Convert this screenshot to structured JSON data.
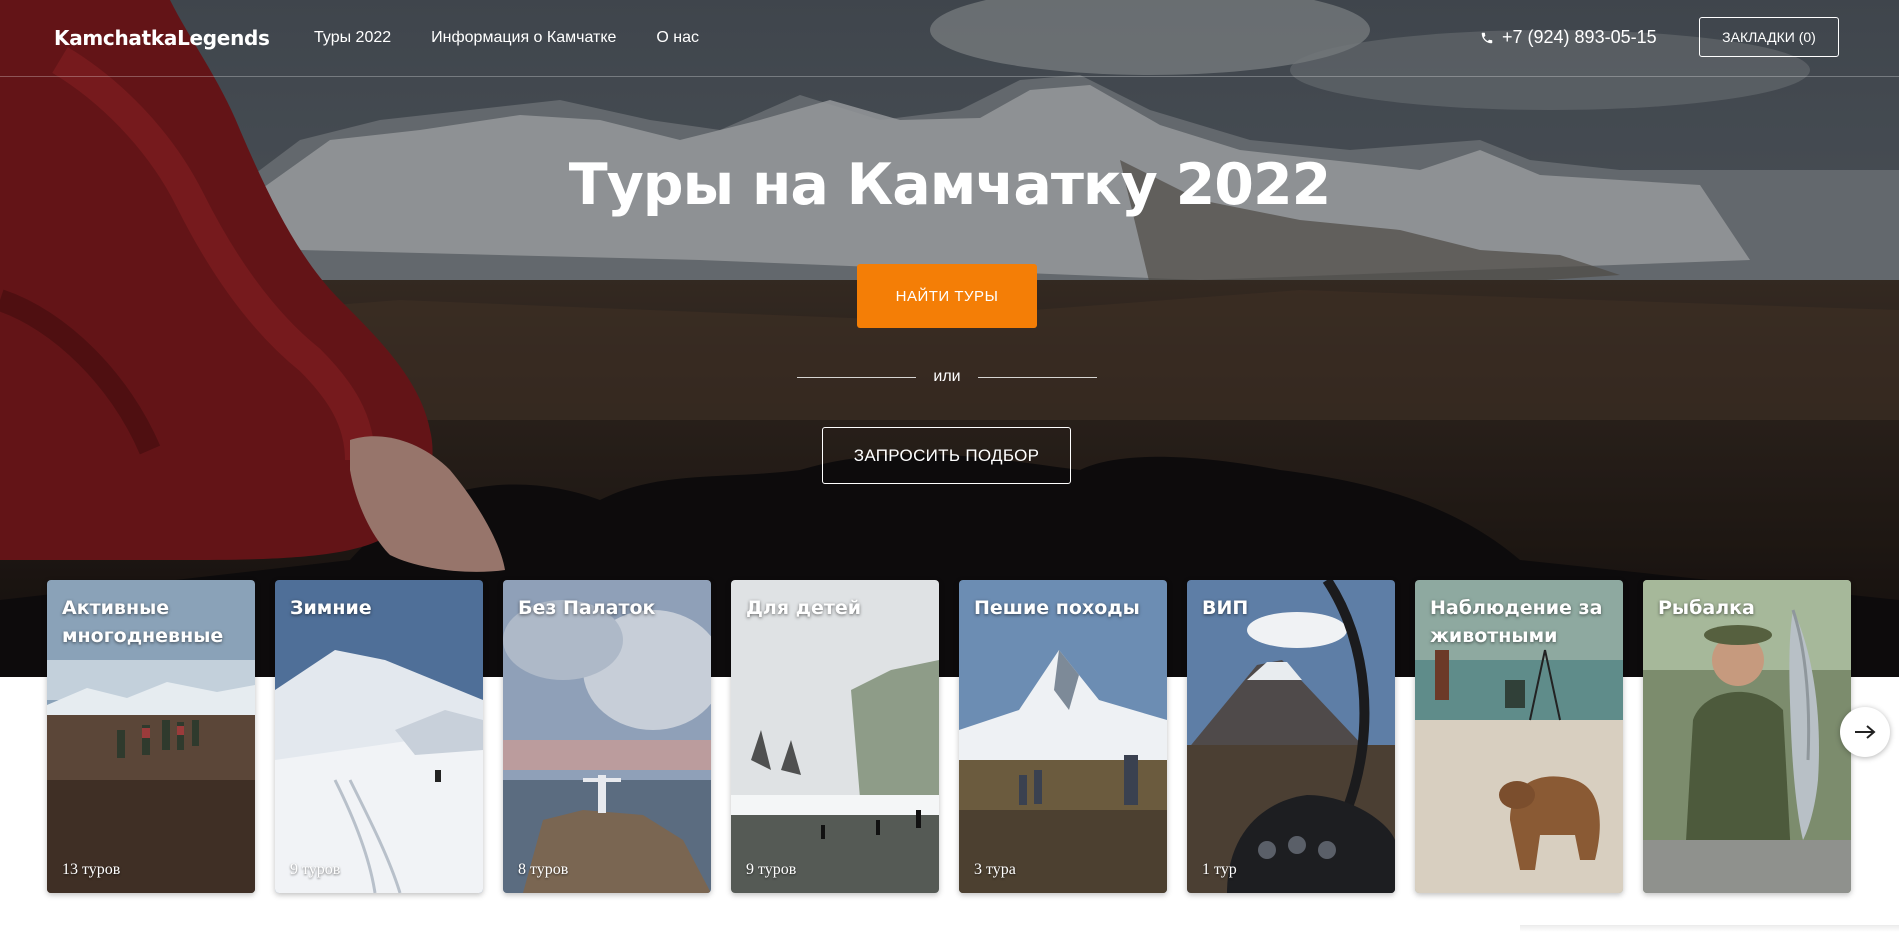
{
  "header": {
    "logo": "KamchatkaLegends",
    "nav": [
      "Туры 2022",
      "Информация о Камчатке",
      "О нас"
    ],
    "phone": "+7 (924) 893-05-15",
    "bookmarks_label": "ЗАКЛАДКИ (0)"
  },
  "hero": {
    "title": "Туры на Камчатку 2022",
    "find_button": "НАЙТИ ТУРЫ",
    "or_text": "или",
    "request_button": "ЗАПРОСИТЬ ПОДБОР"
  },
  "categories": [
    {
      "title": "Активные многодневные",
      "count": "13 туров"
    },
    {
      "title": "Зимние",
      "count": "9 туров"
    },
    {
      "title": "Без Палаток",
      "count": "8 туров"
    },
    {
      "title": "Для детей",
      "count": "9 туров"
    },
    {
      "title": "Пешие походы",
      "count": "3 тура"
    },
    {
      "title": "ВИП",
      "count": "1 тур"
    },
    {
      "title": "Наблюдение за животными",
      "count": ""
    },
    {
      "title": "Рыбалка",
      "count": ""
    }
  ],
  "icons": {
    "phone": "phone-icon",
    "next": "arrow-right-icon"
  },
  "colors": {
    "accent": "#f47e06",
    "text_on_dark": "#ffffff"
  }
}
